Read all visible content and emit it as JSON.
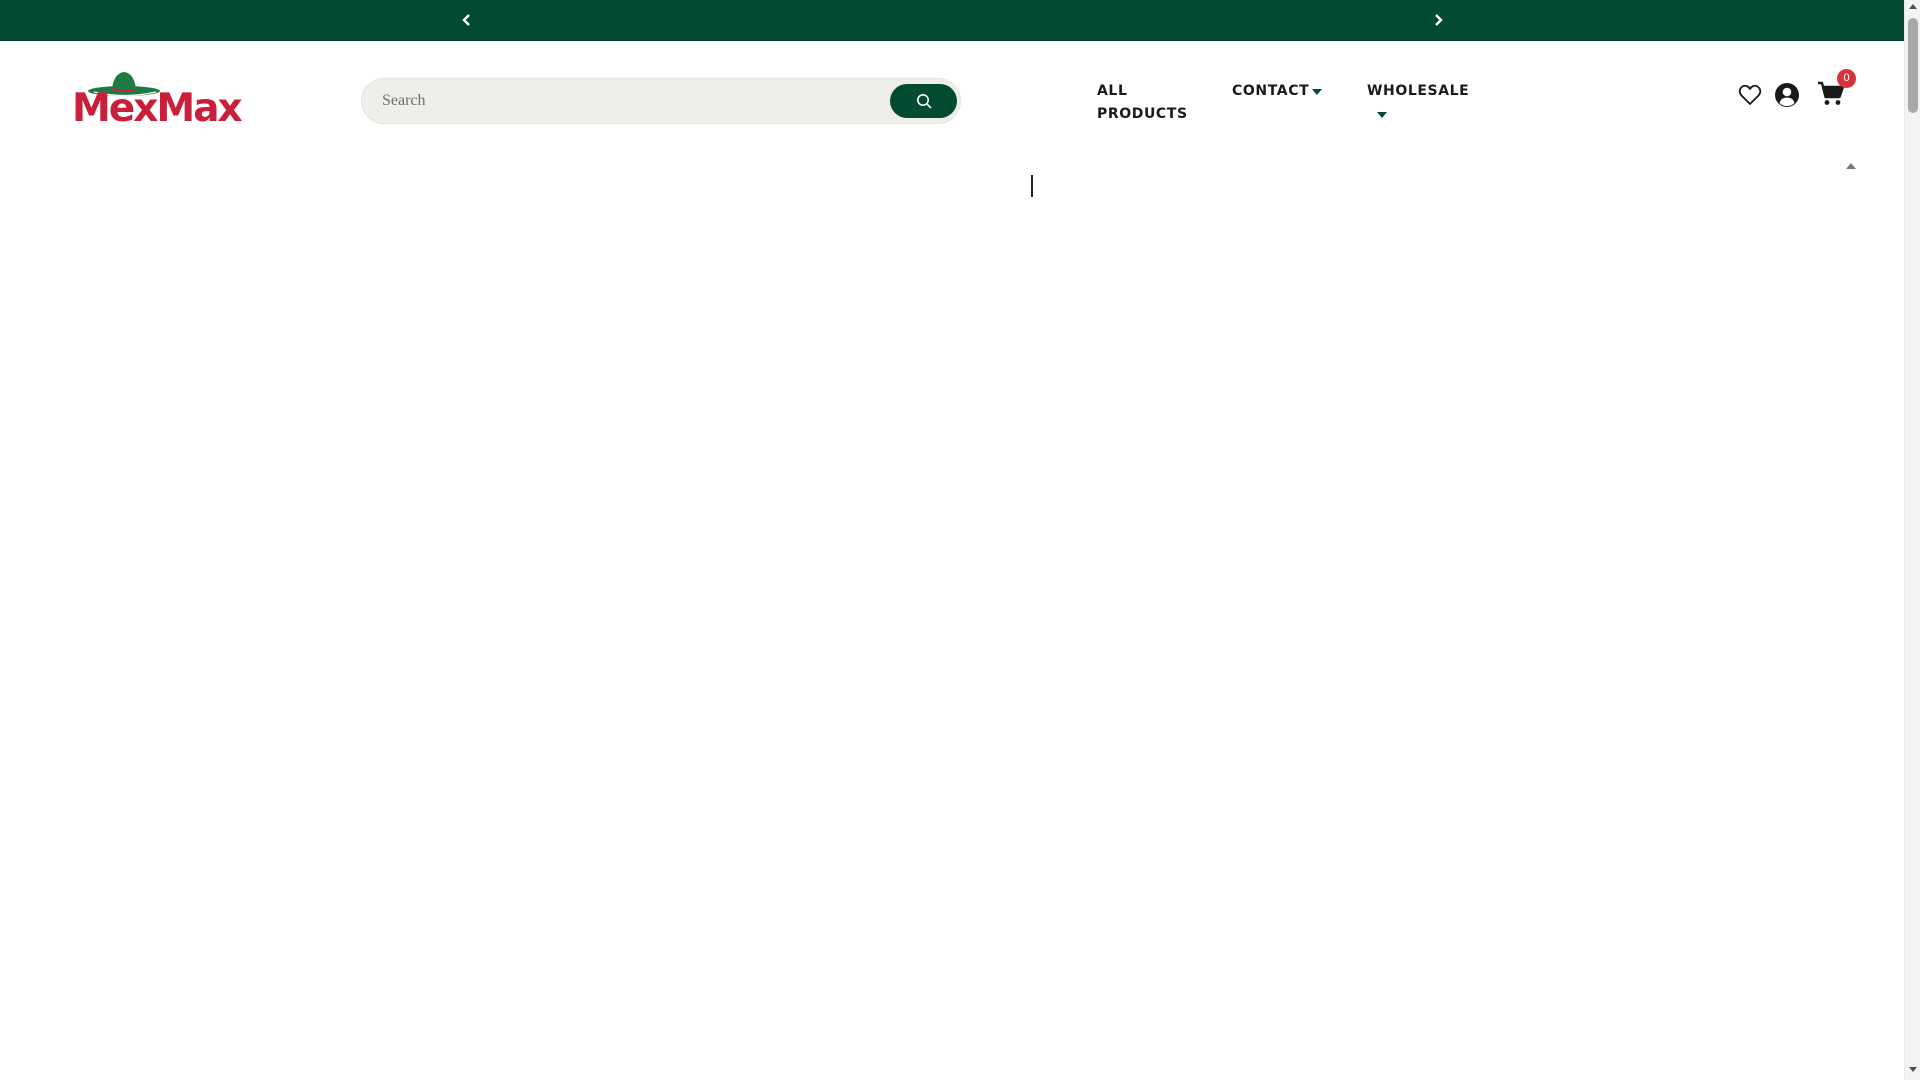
{
  "announcement": {
    "prev_icon": "chevron-left-icon",
    "next_icon": "chevron-right-icon",
    "background_color": "#024b30"
  },
  "logo": {
    "text": "MexMax",
    "icon": "sombrero-icon",
    "brand_color": "#c8203a",
    "hat_color": "#1e7a45"
  },
  "search": {
    "placeholder": "Search",
    "value": "",
    "button_icon": "search-icon",
    "button_color": "#024b30"
  },
  "nav": {
    "items": [
      {
        "label": "ALL PRODUCTS",
        "has_dropdown": false
      },
      {
        "label": "CONTACT",
        "has_dropdown": true
      },
      {
        "label": "WHOLESALE",
        "has_dropdown": true
      }
    ]
  },
  "header_icons": {
    "wishlist_icon": "heart-icon",
    "account_icon": "user-circle-icon",
    "cart_icon": "shopping-cart-icon",
    "cart_count": "0",
    "badge_color": "#d8323a"
  }
}
